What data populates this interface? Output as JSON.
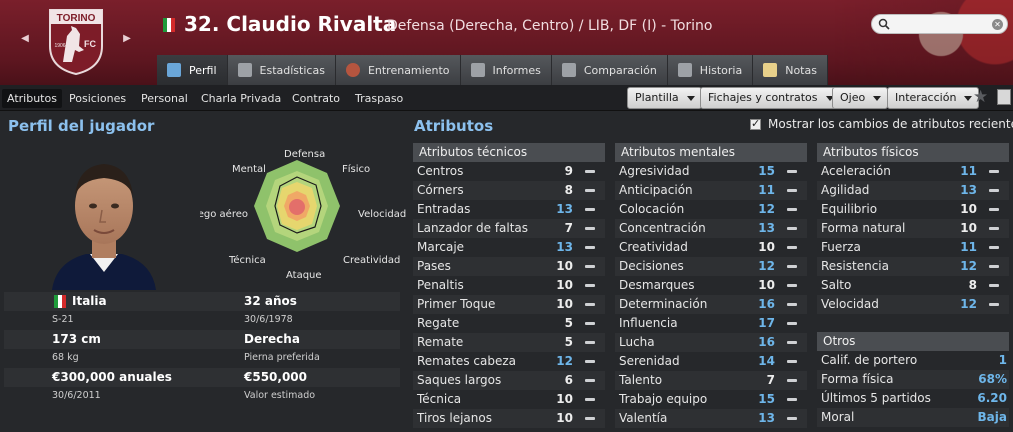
{
  "header": {
    "club": "TORINO",
    "crest_letters": "FC",
    "crest_year": "1906",
    "player_title": "32. Claudio Rivalta",
    "player_sub": "Defensa (Derecha, Centro) / LIB, DF (I) - Torino",
    "brand_color": "#6e1a25",
    "flag_colors": [
      "#1f9a3a",
      "#ffffff",
      "#d32a2a"
    ]
  },
  "search": {
    "placeholder": ""
  },
  "main_tabs": [
    {
      "label": "Perfil",
      "icon": "profile-icon"
    },
    {
      "label": "Estadísticas",
      "icon": "stats-icon"
    },
    {
      "label": "Entrenamiento",
      "icon": "training-icon"
    },
    {
      "label": "Informes",
      "icon": "report-icon"
    },
    {
      "label": "Comparación",
      "icon": "compare-icon"
    },
    {
      "label": "Historia",
      "icon": "history-icon"
    },
    {
      "label": "Notas",
      "icon": "notes-icon"
    }
  ],
  "sub_tabs": [
    "Atributos",
    "Posiciones",
    "Personal",
    "Charla Privada",
    "Contrato",
    "Traspaso"
  ],
  "dropdowns": [
    "Plantilla",
    "Fichajes y contratos",
    "Ojeo",
    "Interacción"
  ],
  "profile": {
    "title": "Perfil del jugador",
    "radar_labels": {
      "defensa": "Defensa",
      "fisico": "Físico",
      "velocidad": "Velocidad",
      "creatividad": "Creatividad",
      "ataque": "Ataque",
      "tecnica": "Técnica",
      "juego_aereo": "Juego aéreo",
      "mental": "Mental"
    },
    "nationality": "Italia",
    "youth": "S-21",
    "age": "32 años",
    "birth": "30/6/1978",
    "height": "173 cm",
    "weight": "68 kg",
    "foot": "Derecha",
    "foot_label": "Pierna preferida",
    "wage": "€300,000 anuales",
    "contract_end": "30/6/2011",
    "value": "€550,000",
    "value_label": "Valor estimado"
  },
  "attributes": {
    "title": "Atributos",
    "show_changes_label": "Mostrar los cambios de atributos recientes",
    "show_changes": true,
    "technical_title": "Atributos técnicos",
    "technical": [
      {
        "name": "Centros",
        "value": "9",
        "hi": false
      },
      {
        "name": "Córners",
        "value": "8",
        "hi": false
      },
      {
        "name": "Entradas",
        "value": "13",
        "hi": true
      },
      {
        "name": "Lanzador de faltas",
        "value": "7",
        "hi": false
      },
      {
        "name": "Marcaje",
        "value": "13",
        "hi": true
      },
      {
        "name": "Pases",
        "value": "10",
        "hi": false
      },
      {
        "name": "Penaltis",
        "value": "10",
        "hi": false
      },
      {
        "name": "Primer Toque",
        "value": "10",
        "hi": false
      },
      {
        "name": "Regate",
        "value": "5",
        "hi": false
      },
      {
        "name": "Remate",
        "value": "5",
        "hi": false
      },
      {
        "name": "Remates cabeza",
        "value": "12",
        "hi": true
      },
      {
        "name": "Saques largos",
        "value": "6",
        "hi": false
      },
      {
        "name": "Técnica",
        "value": "10",
        "hi": false
      },
      {
        "name": "Tiros lejanos",
        "value": "10",
        "hi": false
      }
    ],
    "mental_title": "Atributos mentales",
    "mental": [
      {
        "name": "Agresividad",
        "value": "15",
        "hi": true
      },
      {
        "name": "Anticipación",
        "value": "11",
        "hi": true
      },
      {
        "name": "Colocación",
        "value": "12",
        "hi": true
      },
      {
        "name": "Concentración",
        "value": "13",
        "hi": true
      },
      {
        "name": "Creatividad",
        "value": "10",
        "hi": false
      },
      {
        "name": "Decisiones",
        "value": "12",
        "hi": true
      },
      {
        "name": "Desmarques",
        "value": "10",
        "hi": false
      },
      {
        "name": "Determinación",
        "value": "16",
        "hi": true
      },
      {
        "name": "Influencia",
        "value": "17",
        "hi": true
      },
      {
        "name": "Lucha",
        "value": "16",
        "hi": true
      },
      {
        "name": "Serenidad",
        "value": "14",
        "hi": true
      },
      {
        "name": "Talento",
        "value": "7",
        "hi": false
      },
      {
        "name": "Trabajo equipo",
        "value": "15",
        "hi": true
      },
      {
        "name": "Valentía",
        "value": "13",
        "hi": true
      }
    ],
    "physical_title": "Atributos físicos",
    "physical": [
      {
        "name": "Aceleración",
        "value": "11",
        "hi": true
      },
      {
        "name": "Agilidad",
        "value": "13",
        "hi": true
      },
      {
        "name": "Equilibrio",
        "value": "10",
        "hi": false
      },
      {
        "name": "Forma natural",
        "value": "10",
        "hi": false
      },
      {
        "name": "Fuerza",
        "value": "11",
        "hi": true
      },
      {
        "name": "Resistencia",
        "value": "12",
        "hi": true
      },
      {
        "name": "Salto",
        "value": "8",
        "hi": false
      },
      {
        "name": "Velocidad",
        "value": "12",
        "hi": true
      }
    ],
    "others_title": "Otros",
    "others": [
      {
        "name": "Calif. de portero",
        "value": "1"
      },
      {
        "name": "Forma física",
        "value": "68%"
      },
      {
        "name": "Últimos 5 partidos",
        "value": "6.20"
      },
      {
        "name": "Moral",
        "value": "Baja"
      }
    ]
  }
}
